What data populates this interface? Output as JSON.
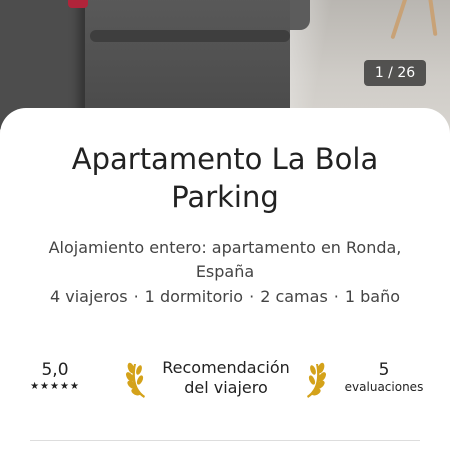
{
  "gallery": {
    "counter": "1 / 26"
  },
  "listing": {
    "title": "Apartamento La Bola Parking",
    "subtitle": "Alojamiento entero: apartamento en Ronda, España",
    "details": [
      "4 viajeros",
      "1 dormitorio",
      "2 camas",
      "1 baño"
    ],
    "separator": "·"
  },
  "stats": {
    "rating": "5,0",
    "stars": "★★★★★",
    "star_count": 5,
    "badge_label": "Recomendación del viajero",
    "reviews_count": "5",
    "reviews_label": "evaluaciones"
  },
  "colors": {
    "laurel": "#d4a21a",
    "text": "#222222",
    "secondary_text": "#444444"
  },
  "icons": {
    "laurel_left": "laurel-left-icon",
    "laurel_right": "laurel-right-icon",
    "star": "star-icon"
  }
}
